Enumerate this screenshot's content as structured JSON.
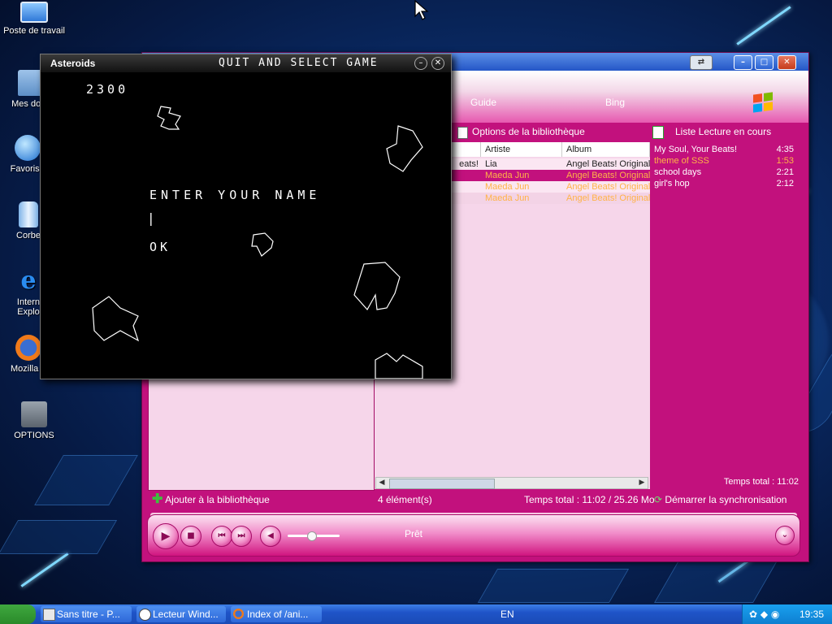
{
  "desktop": {
    "icons": [
      {
        "label": "Poste de travail",
        "icon": "computer-icon"
      },
      {
        "label": "Mes docu",
        "icon": "my-documents-icon"
      },
      {
        "label": "Favoris r",
        "icon": "favorites-icon"
      },
      {
        "label": "Corbe",
        "icon": "recycle-bin-icon"
      },
      {
        "label": "Intern Explo",
        "icon": "internet-explorer-icon"
      },
      {
        "label": "Mozilla F",
        "icon": "firefox-icon"
      },
      {
        "label": "OPTIONS",
        "icon": "folder-icon"
      }
    ]
  },
  "asteroids": {
    "title": "Asteroids",
    "quit_label": "QUIT AND SELECT GAME",
    "score": "2300",
    "prompt": "ENTER YOUR NAME",
    "cursor": "|",
    "ok_label": "OK"
  },
  "wmp": {
    "tabs": [
      "Guide",
      "Bing"
    ],
    "library_options": "Options de la bibliothèque",
    "now_playing_list": "Liste Lecture en cours",
    "columns": [
      "Artiste",
      "Album"
    ],
    "tracks": [
      {
        "title": "eats!",
        "artist": "Lia",
        "album": "Angel Beats! Original"
      },
      {
        "title": "",
        "artist": "Maeda Jun",
        "album": "Angel Beats! Original"
      },
      {
        "title": "",
        "artist": "Maeda Jun",
        "album": "Angel Beats! Original"
      },
      {
        "title": "",
        "artist": "Maeda Jun",
        "album": "Angel Beats! Original"
      }
    ],
    "playlist": [
      {
        "title": "My Soul, Your Beats!",
        "duration": "4:35"
      },
      {
        "title": "theme of SSS",
        "duration": "1:53"
      },
      {
        "title": "school days",
        "duration": "2:21"
      },
      {
        "title": "girl's hop",
        "duration": "2:12"
      }
    ],
    "playlist_total": "Temps total : 11:02",
    "add_to_library": "Ajouter à la bibliothèque",
    "item_count": "4 élément(s)",
    "total_time": "Temps total : 11:02 / 25.26 Mo",
    "sync_label": "Démarrer la synchronisation",
    "status": "Prêt",
    "colors": {
      "pink": "#c2117d",
      "highlight": "#ffb347"
    }
  },
  "taskbar": {
    "items": [
      {
        "label": "Sans titre - P...",
        "icon": "paint-icon"
      },
      {
        "label": "Lecteur Wind...",
        "icon": "media-player-icon"
      },
      {
        "label": "Index of /ani...",
        "icon": "firefox-icon"
      }
    ],
    "language": "EN",
    "clock": "19:35"
  }
}
